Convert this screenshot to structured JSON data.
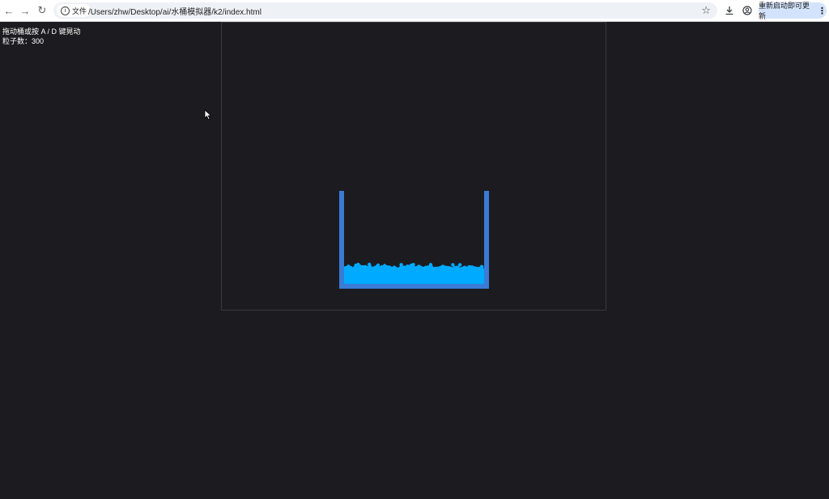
{
  "browser": {
    "site_chip_label": "文件",
    "url": "/Users/zhw/Desktop/ai/水桶模拟器/k2/index.html",
    "update_button_label": "重新启动即可更新"
  },
  "hud": {
    "instruction": "拖动桶或按 A / D 键晃动",
    "particle_label": "粒子数：",
    "particle_count": "300"
  },
  "colors": {
    "page_background": "#1c1b1f",
    "bucket": "#3a7bd5",
    "water": "#00aaff"
  }
}
